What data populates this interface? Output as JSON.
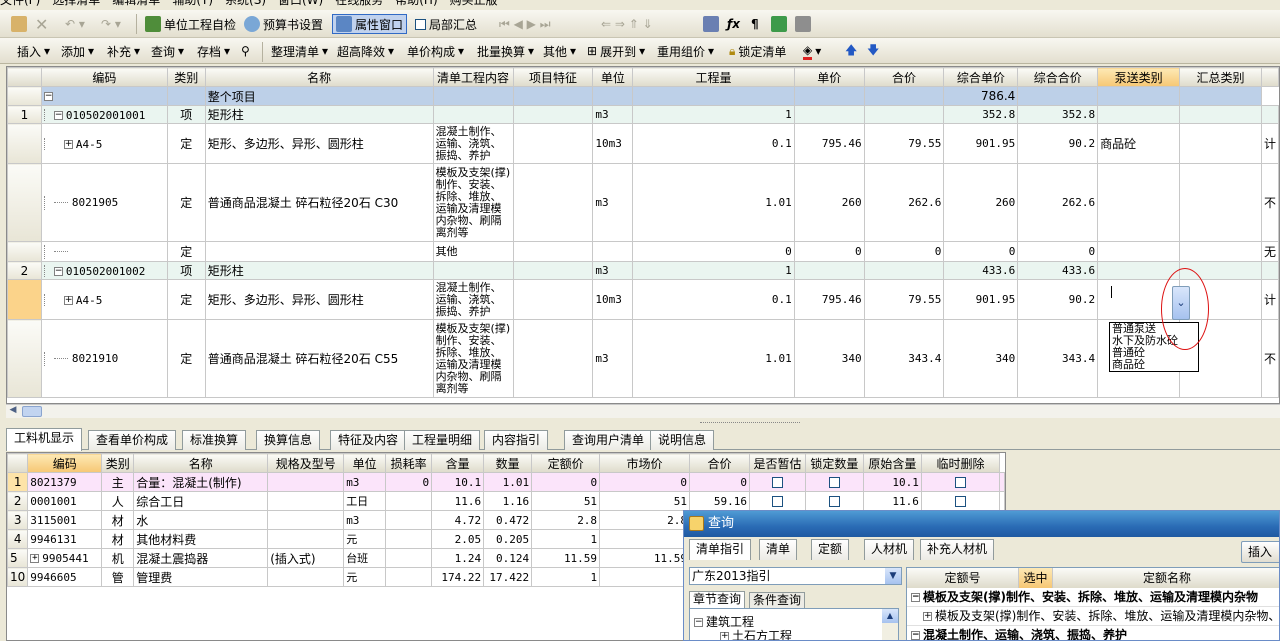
{
  "menubar": [
    "文件(F)",
    "选择清单",
    "编辑清单",
    "辅助(T)",
    "系统(S)",
    "窗口(W)",
    "在线服务",
    "帮助(H)",
    "购买正版"
  ],
  "toolbar1": {
    "self_check": "单位工程自检",
    "budget_settings": "预算书设置",
    "property_window": "属性窗口",
    "partial_summary": "局部汇总"
  },
  "toolbar2": {
    "insert": "插入",
    "add": "添加",
    "supplement": "补充",
    "query": "查询",
    "store": "存档",
    "organize": "整理清单",
    "super_height": "超高降效",
    "unit_price": "单价构成",
    "batch_convert": "批量换算",
    "other": "其他",
    "expand": "展开到",
    "reuse": "重用组价",
    "lock": "锁定清单"
  },
  "grid": {
    "headers": [
      "编码",
      "类别",
      "名称",
      "清单工程内容",
      "项目特征",
      "单位",
      "工程量",
      "单价",
      "合价",
      "综合单价",
      "综合合价",
      "泵送类别",
      "汇总类别"
    ],
    "total": {
      "name": "整个项目",
      "amount": "786.4"
    },
    "rows": [
      {
        "no": "1",
        "code": "010502001001",
        "type": "项",
        "name": "矩形柱",
        "content": "",
        "unit": "m3",
        "qty": "1",
        "price": "",
        "total": "",
        "cprice": "352.8",
        "ctotal": "352.8",
        "pump": "",
        "sum": ""
      },
      {
        "no": "",
        "code": "A4-5",
        "type": "定",
        "name": "矩形、多边形、异形、圆形柱",
        "content": "混凝土制作、运输、浇筑、振捣、养护",
        "unit": "10m3",
        "qty": "0.1",
        "price": "795.46",
        "total": "79.55",
        "cprice": "901.95",
        "ctotal": "90.2",
        "pump": "商品砼",
        "sum": "计"
      },
      {
        "no": "",
        "code": "8021905",
        "type": "定",
        "name": "普通商品混凝土 碎石粒径20石 C30",
        "content": "模板及支架(撑)制作、安装、拆除、堆放、运输及清理模内杂物、刷隔离剂等",
        "unit": "m3",
        "qty": "1.01",
        "price": "260",
        "total": "262.6",
        "cprice": "260",
        "ctotal": "262.6",
        "pump": "",
        "sum": "不"
      },
      {
        "no": "",
        "code": "",
        "type": "定",
        "name": "",
        "content": "其他",
        "unit": "",
        "qty": "0",
        "price": "0",
        "total": "0",
        "cprice": "0",
        "ctotal": "0",
        "pump": "",
        "sum": "无"
      },
      {
        "no": "2",
        "code": "010502001002",
        "type": "项",
        "name": "矩形柱",
        "content": "",
        "unit": "m3",
        "qty": "1",
        "price": "",
        "total": "",
        "cprice": "433.6",
        "ctotal": "433.6",
        "pump": "",
        "sum": ""
      },
      {
        "no": "",
        "code": "A4-5",
        "type": "定",
        "name": "矩形、多边形、异形、圆形柱",
        "content": "混凝土制作、运输、浇筑、振捣、养护",
        "unit": "10m3",
        "qty": "0.1",
        "price": "795.46",
        "total": "79.55",
        "cprice": "901.95",
        "ctotal": "90.2",
        "pump": "",
        "sum": "计"
      },
      {
        "no": "",
        "code": "8021910",
        "type": "定",
        "name": "普通商品混凝土 碎石粒径20石 C55",
        "content": "模板及支架(撑)制作、安装、拆除、堆放、运输及清理模内杂物、刷隔离剂等",
        "unit": "m3",
        "qty": "1.01",
        "price": "340",
        "total": "343.4",
        "cprice": "340",
        "ctotal": "343.4",
        "pump": "",
        "sum": "不"
      }
    ],
    "dropdown_options": [
      "普通泵送",
      "水下及防水砼",
      "普通砼",
      "商品砼"
    ]
  },
  "tabs": [
    "工料机显示",
    "查看单价构成",
    "标准换算",
    "换算信息",
    "特征及内容",
    "工程量明细",
    "内容指引",
    "查询用户清单",
    "说明信息"
  ],
  "bottom": {
    "headers": [
      "编码",
      "类别",
      "名称",
      "规格及型号",
      "单位",
      "损耗率",
      "含量",
      "数量",
      "定额价",
      "市场价",
      "合价",
      "是否暂估",
      "锁定数量",
      "原始含量",
      "临时删除"
    ],
    "rows": [
      {
        "no": "1",
        "code": "8021379",
        "type": "主",
        "name": "合量：混凝土(制作)",
        "spec": "",
        "unit": "m3",
        "loss": "0",
        "content": "10.1",
        "qty": "1.01",
        "qprice": "0",
        "mprice": "0",
        "total": "0",
        "orig": "10.1",
        "est": true,
        "lock": true,
        "del": true
      },
      {
        "no": "2",
        "code": "0001001",
        "type": "人",
        "name": "综合工日",
        "spec": "",
        "unit": "工日",
        "loss": "",
        "content": "11.6",
        "qty": "1.16",
        "qprice": "51",
        "mprice": "51",
        "total": "59.16",
        "orig": "11.6",
        "est": true,
        "lock": true,
        "del": true
      },
      {
        "no": "3",
        "code": "3115001",
        "type": "材",
        "name": "水",
        "spec": "",
        "unit": "m3",
        "loss": "",
        "content": "4.72",
        "qty": "0.472",
        "qprice": "2.8",
        "mprice": "2.8",
        "total": "",
        "orig": "",
        "est": false,
        "lock": false,
        "del": false
      },
      {
        "no": "4",
        "code": "9946131",
        "type": "材",
        "name": "其他材料费",
        "spec": "",
        "unit": "元",
        "loss": "",
        "content": "2.05",
        "qty": "0.205",
        "qprice": "1",
        "mprice": "",
        "total": "",
        "orig": "",
        "est": false,
        "lock": false,
        "del": false
      },
      {
        "no": "5",
        "code": "9905441",
        "type": "机",
        "name": "混凝土震捣器",
        "spec": "(插入式)",
        "unit": "台班",
        "loss": "",
        "content": "1.24",
        "qty": "0.124",
        "qprice": "11.59",
        "mprice": "11.59",
        "total": "",
        "orig": "",
        "est": false,
        "lock": false,
        "del": false
      },
      {
        "no": "10",
        "code": "9946605",
        "type": "管",
        "name": "管理费",
        "spec": "",
        "unit": "元",
        "loss": "",
        "content": "174.22",
        "qty": "17.422",
        "qprice": "1",
        "mprice": "",
        "total": "",
        "orig": "",
        "est": false,
        "lock": false,
        "del": false
      }
    ]
  },
  "query": {
    "title": "查询",
    "tabs": [
      "清单指引",
      "清单",
      "定额",
      "人材机",
      "补充人材机"
    ],
    "insert": "插入",
    "select": "广东2013指引",
    "subtabs": [
      "章节查询",
      "条件查询"
    ],
    "tree": [
      "建筑工程",
      "土石方工程"
    ],
    "right_headers": [
      "定额号",
      "选中",
      "定额名称"
    ],
    "right_rows": [
      "模板及支架(撑)制作、安装、拆除、堆放、运输及清理模内杂物",
      "模板及支架(撑)制作、安装、拆除、堆放、运输及清理模内杂物、",
      "混凝土制作、运输、浇筑、振捣、养护"
    ]
  }
}
